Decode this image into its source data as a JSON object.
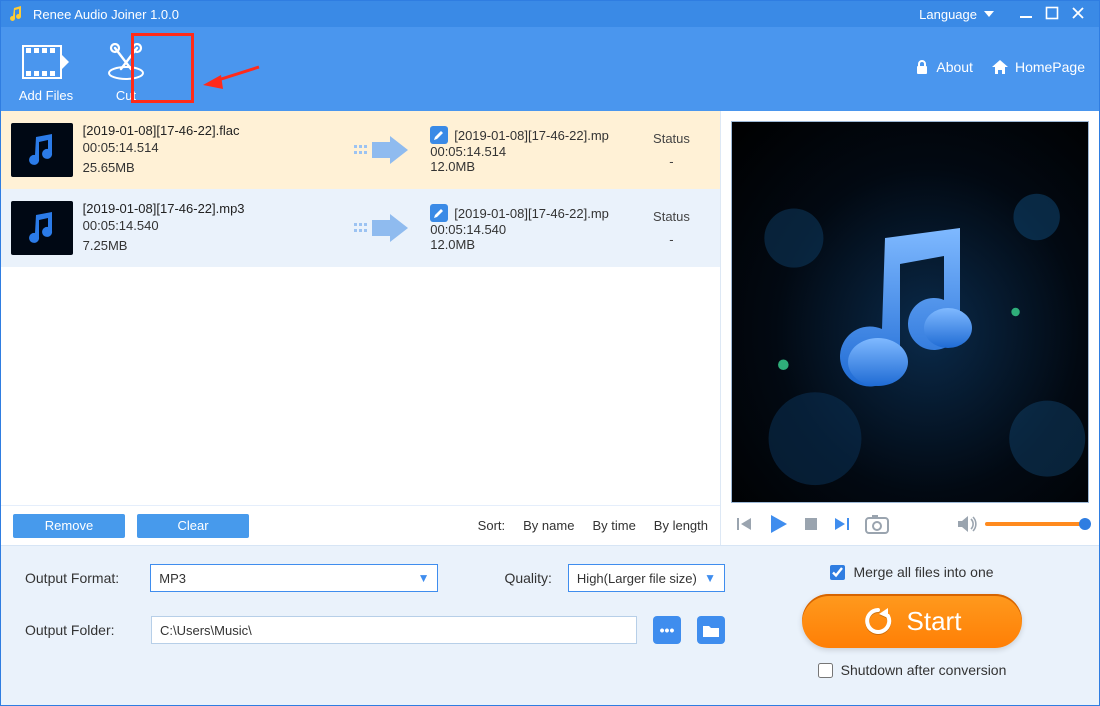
{
  "titlebar": {
    "app_name": "Renee Audio Joiner 1.0.0",
    "language_label": "Language"
  },
  "toolbar": {
    "add_files": "Add Files",
    "cut": "Cut",
    "about": "About",
    "homepage": "HomePage"
  },
  "files": [
    {
      "src_name": "[2019-01-08][17-46-22].flac",
      "src_dur": "00:05:14.514",
      "src_size": "25.65MB",
      "dst_name": "[2019-01-08][17-46-22].mp",
      "dst_dur": "00:05:14.514",
      "dst_size": "12.0MB",
      "status_label": "Status",
      "status_value": "-"
    },
    {
      "src_name": "[2019-01-08][17-46-22].mp3",
      "src_dur": "00:05:14.540",
      "src_size": "7.25MB",
      "dst_name": "[2019-01-08][17-46-22].mp",
      "dst_dur": "00:05:14.540",
      "dst_size": "12.0MB",
      "status_label": "Status",
      "status_value": "-"
    }
  ],
  "listbar": {
    "remove": "Remove",
    "clear": "Clear",
    "sort_label": "Sort:",
    "by_name": "By name",
    "by_time": "By time",
    "by_length": "By length"
  },
  "footer": {
    "merge_label": "Merge all files into one",
    "merge_checked": true,
    "output_format_label": "Output Format:",
    "output_format_value": "MP3",
    "quality_label": "Quality:",
    "quality_value": "High(Larger file size)",
    "output_folder_label": "Output Folder:",
    "output_folder_value": "C:\\Users\\Music\\",
    "start_label": "Start",
    "shutdown_label": "Shutdown after conversion",
    "shutdown_checked": false
  }
}
